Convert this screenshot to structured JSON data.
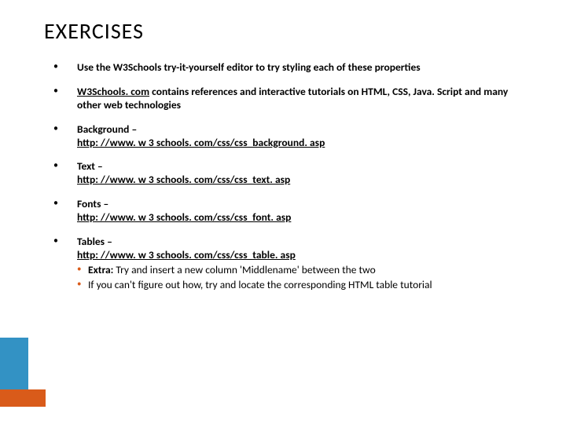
{
  "title": "EXERCISES",
  "bullets": {
    "b1": "Use the W3Schools try-it-yourself editor to try styling each of these properties",
    "b2": {
      "strong1": "W3Schools. com",
      "rest": " contains references and interactive tutorials on HTML, CSS, Java. Script and many other web technologies"
    },
    "b3": {
      "label": "Background – ",
      "url": "http: //www. w 3 schools. com/css/css_background. asp"
    },
    "b4": {
      "label": "Text – ",
      "url": "http: //www. w 3 schools. com/css/css_text. asp"
    },
    "b5": {
      "label": "Fonts – ",
      "url": "http: //www. w 3 schools. com/css/css_font. asp"
    },
    "b6": {
      "label": "Tables – ",
      "url": "http: //www. w 3 schools. com/css/css_table. asp",
      "sub": {
        "s1_strong": "Extra:",
        "s1_rest": " Try and insert a new column 'Middlename' between the two",
        "s2": "If you can't figure out how, try and locate the corresponding HTML table tutorial"
      }
    }
  }
}
